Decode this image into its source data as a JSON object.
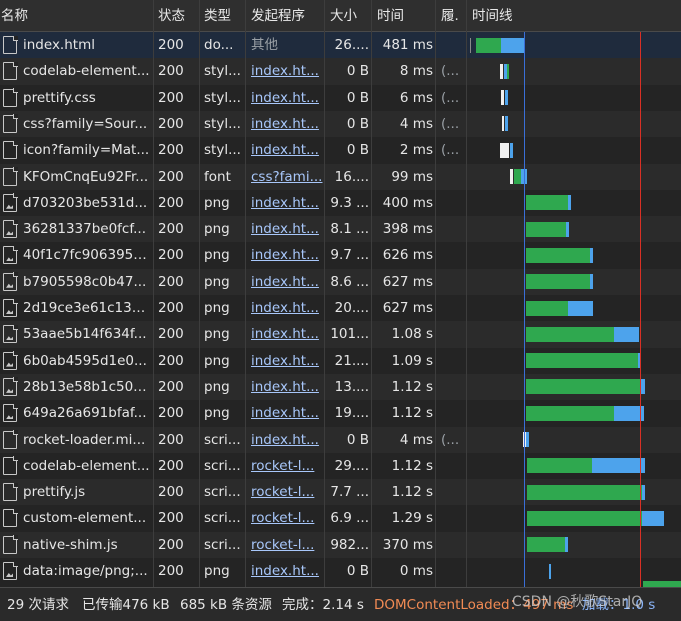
{
  "columns": {
    "name": "名称",
    "status": "状态",
    "type": "类型",
    "initiator": "发起程序",
    "size": "大小",
    "time": "时间",
    "fulfilled": "履.",
    "waterfall": "时间线"
  },
  "rows": [
    {
      "name": "index.html",
      "status": "200",
      "type": "do...",
      "initiator": "其他",
      "initiator_link": false,
      "size": "26....",
      "time": "481 ms",
      "fulfilled": "",
      "icon": "document-icon",
      "selected": true
    },
    {
      "name": "codelab-element...",
      "status": "200",
      "type": "styl...",
      "initiator": "index.ht...",
      "initiator_link": true,
      "size": "0 B",
      "time": "8 ms",
      "fulfilled": "(...",
      "icon": "file-icon"
    },
    {
      "name": "prettify.css",
      "status": "200",
      "type": "styl...",
      "initiator": "index.ht...",
      "initiator_link": true,
      "size": "0 B",
      "time": "6 ms",
      "fulfilled": "(...",
      "icon": "file-icon"
    },
    {
      "name": "css?family=Sour...",
      "status": "200",
      "type": "styl...",
      "initiator": "index.ht...",
      "initiator_link": true,
      "size": "0 B",
      "time": "4 ms",
      "fulfilled": "(...",
      "icon": "file-icon"
    },
    {
      "name": "icon?family=Mat...",
      "status": "200",
      "type": "styl...",
      "initiator": "index.ht...",
      "initiator_link": true,
      "size": "0 B",
      "time": "2 ms",
      "fulfilled": "(...",
      "icon": "file-icon"
    },
    {
      "name": "KFOmCnqEu92Fr...",
      "status": "200",
      "type": "font",
      "initiator": "css?fami...",
      "initiator_link": true,
      "size": "16....",
      "time": "99 ms",
      "fulfilled": "",
      "icon": "file-icon"
    },
    {
      "name": "d703203be531d...",
      "status": "200",
      "type": "png",
      "initiator": "index.ht...",
      "initiator_link": true,
      "size": "9.3 ...",
      "time": "400 ms",
      "fulfilled": "",
      "icon": "image-file-icon"
    },
    {
      "name": "36281337be0fcf...",
      "status": "200",
      "type": "png",
      "initiator": "index.ht...",
      "initiator_link": true,
      "size": "8.1 ...",
      "time": "398 ms",
      "fulfilled": "",
      "icon": "image-file-icon"
    },
    {
      "name": "40f1c7fc9063959...",
      "status": "200",
      "type": "png",
      "initiator": "index.ht...",
      "initiator_link": true,
      "size": "9.7 ...",
      "time": "626 ms",
      "fulfilled": "",
      "icon": "image-file-icon"
    },
    {
      "name": "b7905598c0b47...",
      "status": "200",
      "type": "png",
      "initiator": "index.ht...",
      "initiator_link": true,
      "size": "8.6 ...",
      "time": "627 ms",
      "fulfilled": "",
      "icon": "image-file-icon"
    },
    {
      "name": "2d19ce3e61c132...",
      "status": "200",
      "type": "png",
      "initiator": "index.ht...",
      "initiator_link": true,
      "size": "20....",
      "time": "627 ms",
      "fulfilled": "",
      "icon": "image-file-icon"
    },
    {
      "name": "53aae5b14f634f...",
      "status": "200",
      "type": "png",
      "initiator": "index.ht...",
      "initiator_link": true,
      "size": "101...",
      "time": "1.08 s",
      "fulfilled": "",
      "icon": "image-file-icon"
    },
    {
      "name": "6b0ab4595d1e0...",
      "status": "200",
      "type": "png",
      "initiator": "index.ht...",
      "initiator_link": true,
      "size": "21....",
      "time": "1.09 s",
      "fulfilled": "",
      "icon": "image-file-icon"
    },
    {
      "name": "28b13e58b1c50c...",
      "status": "200",
      "type": "png",
      "initiator": "index.ht...",
      "initiator_link": true,
      "size": "13....",
      "time": "1.12 s",
      "fulfilled": "",
      "icon": "image-file-icon"
    },
    {
      "name": "649a26a691bfaf...",
      "status": "200",
      "type": "png",
      "initiator": "index.ht...",
      "initiator_link": true,
      "size": "19....",
      "time": "1.12 s",
      "fulfilled": "",
      "icon": "image-file-icon"
    },
    {
      "name": "rocket-loader.mi...",
      "status": "200",
      "type": "scri...",
      "initiator": "index.ht...",
      "initiator_link": true,
      "size": "0 B",
      "time": "4 ms",
      "fulfilled": "(...",
      "icon": "file-icon"
    },
    {
      "name": "codelab-element...",
      "status": "200",
      "type": "scri...",
      "initiator": "rocket-l...",
      "initiator_link": true,
      "size": "29....",
      "time": "1.12 s",
      "fulfilled": "",
      "icon": "file-icon"
    },
    {
      "name": "prettify.js",
      "status": "200",
      "type": "scri...",
      "initiator": "rocket-l...",
      "initiator_link": true,
      "size": "7.7 ...",
      "time": "1.12 s",
      "fulfilled": "",
      "icon": "file-icon"
    },
    {
      "name": "custom-element...",
      "status": "200",
      "type": "scri...",
      "initiator": "rocket-l...",
      "initiator_link": true,
      "size": "6.9 ...",
      "time": "1.29 s",
      "fulfilled": "",
      "icon": "file-icon"
    },
    {
      "name": "native-shim.js",
      "status": "200",
      "type": "scri...",
      "initiator": "rocket-l...",
      "initiator_link": true,
      "size": "982...",
      "time": "370 ms",
      "fulfilled": "",
      "icon": "file-icon"
    },
    {
      "name": "data:image/png;...",
      "status": "200",
      "type": "png",
      "initiator": "index.ht...",
      "initiator_link": true,
      "size": "0 B",
      "time": "0 ms",
      "fulfilled": "",
      "icon": "image-file-icon"
    }
  ],
  "footer": {
    "requests": "29 次请求",
    "transferred": "已传输476 kB",
    "resources": "685 kB 条资源",
    "finish": "完成：2.14 s",
    "domcontentloaded": "DOMContentLoaded：497 ms",
    "load": "加载：1.0 s"
  },
  "watermark": "CSDN @秋歌StarJQ",
  "colors": {
    "waiting": "#2fa84f",
    "download": "#4da3ec",
    "dcl_line": "#3a6fd8",
    "load_line": "#d93025",
    "dcl_text": "#f28b54",
    "load_text": "#8ab4f8"
  }
}
